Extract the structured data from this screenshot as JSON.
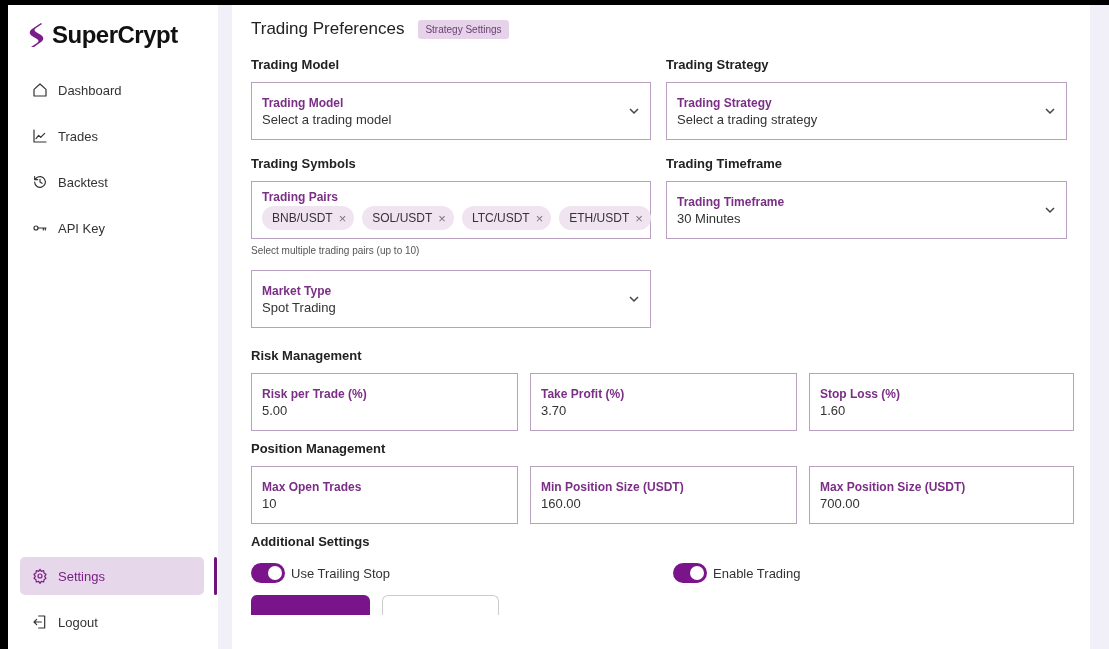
{
  "brand": "SuperCrypt",
  "nav": [
    {
      "label": "Dashboard",
      "selected": false
    },
    {
      "label": "Trades",
      "selected": false
    },
    {
      "label": "Backtest",
      "selected": false
    },
    {
      "label": "API Key",
      "selected": false
    }
  ],
  "nav_bottom": [
    {
      "label": "Settings",
      "selected": true
    },
    {
      "label": "Logout",
      "selected": false
    }
  ],
  "page": {
    "title": "Trading Preferences",
    "badge": "Strategy Settings"
  },
  "trading_model": {
    "heading": "Trading Model",
    "label": "Trading Model",
    "placeholder": "Select a trading model"
  },
  "trading_strategy": {
    "heading": "Trading Strategy",
    "label": "Trading Strategy",
    "placeholder": "Select a trading strategy"
  },
  "trading_symbols": {
    "heading": "Trading Symbols",
    "label": "Trading Pairs",
    "chips": [
      "BNB/USDT",
      "SOL/USDT",
      "LTC/USDT",
      "ETH/USDT"
    ],
    "chip_remove": "×",
    "helper": "Select multiple trading pairs (up to 10)"
  },
  "trading_timeframe": {
    "heading": "Trading Timeframe",
    "label": "Trading Timeframe",
    "value": "30 Minutes"
  },
  "market_type": {
    "label": "Market Type",
    "value": "Spot Trading"
  },
  "risk_management": {
    "heading": "Risk Management",
    "fields": [
      {
        "label": "Risk per Trade (%)",
        "value": "5.00"
      },
      {
        "label": "Take Profit (%)",
        "value": "3.70"
      },
      {
        "label": "Stop Loss (%)",
        "value": "1.60"
      }
    ]
  },
  "position_management": {
    "heading": "Position Management",
    "fields": [
      {
        "label": "Max Open Trades",
        "value": "10"
      },
      {
        "label": "Min Position Size (USDT)",
        "value": "160.00"
      },
      {
        "label": "Max Position Size (USDT)",
        "value": "700.00"
      }
    ]
  },
  "additional_settings": {
    "heading": "Additional Settings",
    "toggles": [
      {
        "label": "Use Trailing Stop",
        "on": true
      },
      {
        "label": "Enable Trading",
        "on": true
      }
    ]
  }
}
